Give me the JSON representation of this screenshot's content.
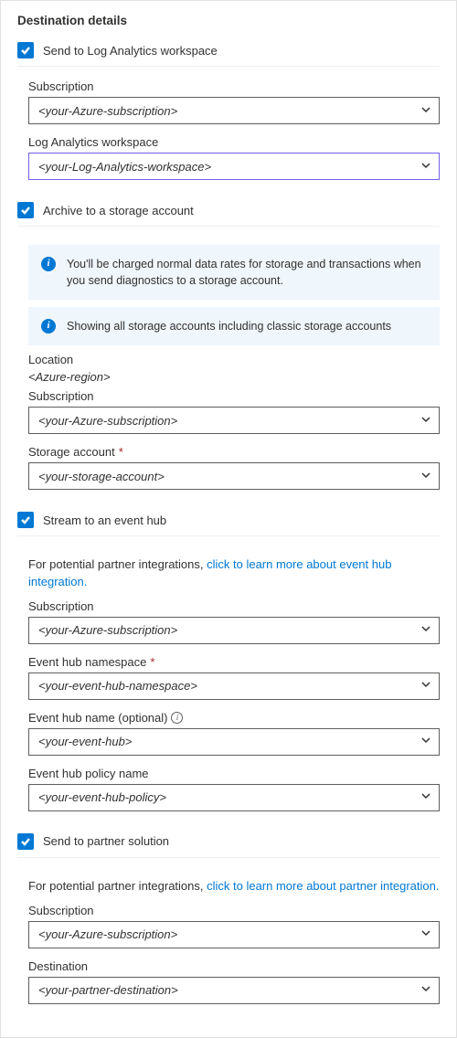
{
  "title": "Destination details",
  "logAnalytics": {
    "checkbox_label": "Send to Log Analytics workspace",
    "subscription_label": "Subscription",
    "subscription_value": "<your-Azure-subscription>",
    "workspace_label": "Log Analytics workspace",
    "workspace_value": "<your-Log-Analytics-workspace>"
  },
  "storage": {
    "checkbox_label": "Archive to a storage account",
    "info1": "You'll be charged normal data rates for storage and transactions when you send diagnostics to a storage account.",
    "info2": "Showing all storage accounts including classic storage accounts",
    "location_label": "Location",
    "location_value": "<Azure-region>",
    "subscription_label": "Subscription",
    "subscription_value": "<your-Azure-subscription>",
    "account_label": "Storage account",
    "account_value": "<your-storage-account>"
  },
  "eventHub": {
    "checkbox_label": "Stream to an event hub",
    "helper_prefix": "For potential partner integrations, ",
    "helper_link": "click to learn more about event hub integration.",
    "subscription_label": "Subscription",
    "subscription_value": "<your-Azure-subscription>",
    "namespace_label": "Event hub namespace",
    "namespace_value": "<your-event-hub-namespace>",
    "name_label": "Event hub name (optional)",
    "name_value": "<your-event-hub>",
    "policy_label": "Event hub policy name",
    "policy_value": "<your-event-hub-policy>"
  },
  "partner": {
    "checkbox_label": "Send to partner solution",
    "helper_prefix": "For potential partner integrations, ",
    "helper_link": "click to learn more about partner integration.",
    "subscription_label": "Subscription",
    "subscription_value": "<your-Azure-subscription>",
    "destination_label": "Destination",
    "destination_value": "<your-partner-destination>"
  }
}
